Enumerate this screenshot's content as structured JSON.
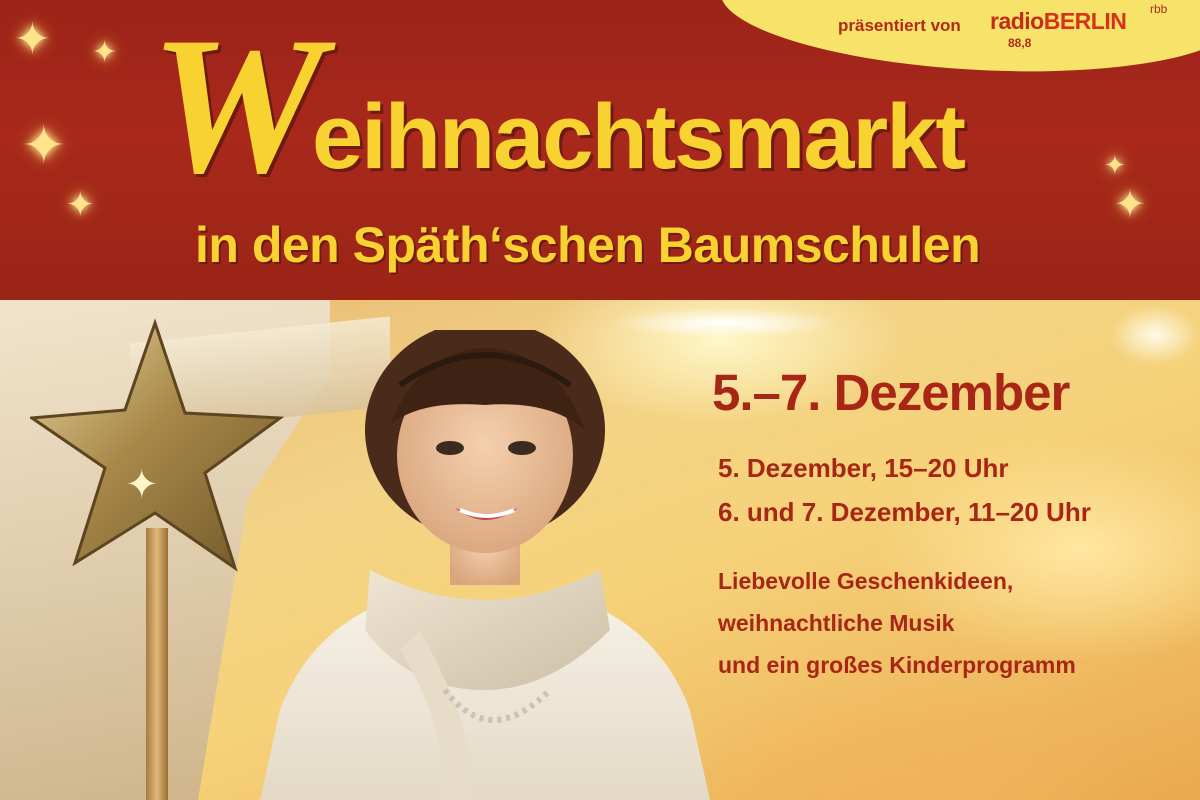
{
  "sponsor": {
    "presented_by": "präsentiert von",
    "radio_prefix": "radio",
    "radio_name": "BERLIN",
    "frequency": "88,8",
    "network": "rbb"
  },
  "title": {
    "initial": "W",
    "rest": "eihnachtsmarkt",
    "subtitle": "in den Späth‘schen Baumschulen"
  },
  "event": {
    "date_range": "5.–7. Dezember",
    "times": [
      "5. Dezember, 15–20 Uhr",
      "6. und 7. Dezember, 11–20 Uhr"
    ],
    "description": [
      "Liebevolle Geschenkideen,",
      "weihnachtliche Musik",
      "und ein großes Kinderprogramm"
    ]
  },
  "colors": {
    "banner_red": "#a8291b",
    "title_yellow": "#f7d230",
    "text_red": "#a82616",
    "sponsor_band": "#f7e36a"
  },
  "icons": [
    "sparkle-icon",
    "star-wand-icon",
    "radio-tower-icon"
  ]
}
